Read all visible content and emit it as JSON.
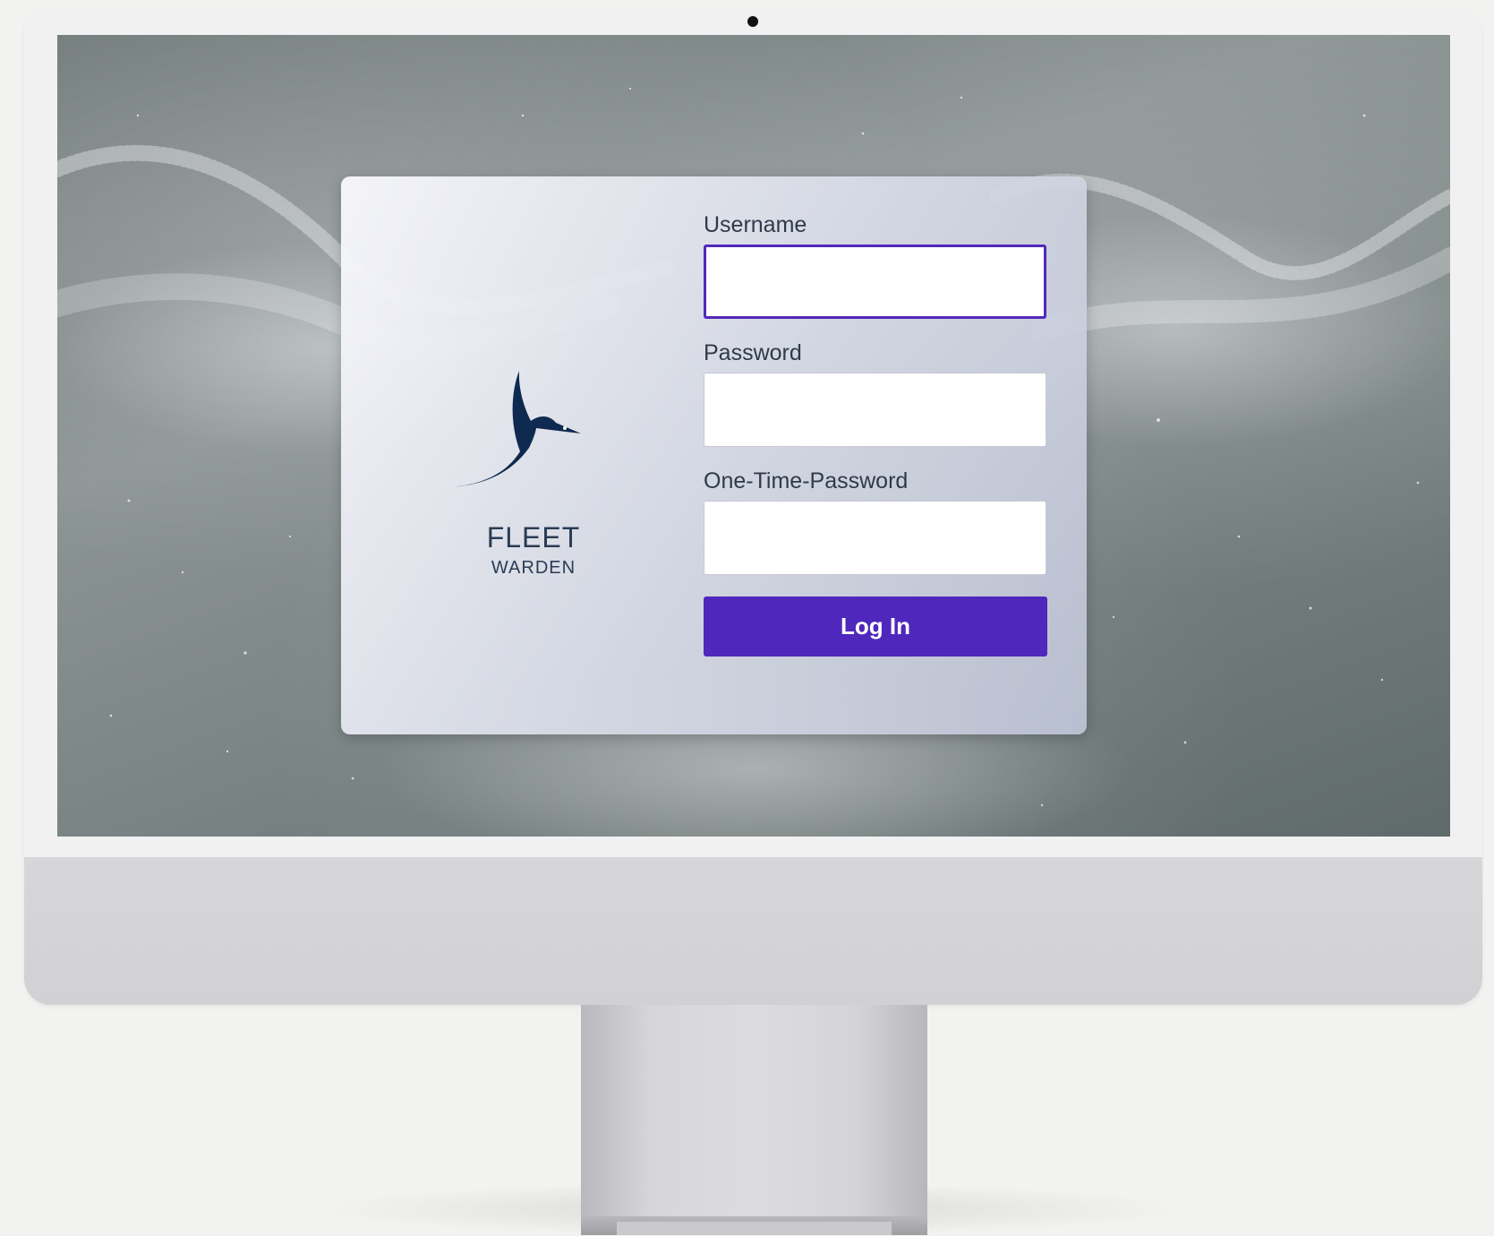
{
  "app": {
    "brand": {
      "name": "FLEET",
      "subtitle": "WARDEN"
    }
  },
  "login": {
    "username_label": "Username",
    "username_value": "",
    "password_label": "Password",
    "password_value": "",
    "otp_label": "One-Time-Password",
    "otp_value": "",
    "submit_label": "Log In"
  },
  "colors": {
    "accent": "#5027bc",
    "brand": "#0e2a50",
    "label_text": "#2f3a4a"
  },
  "icons": {
    "logo": "bird-logo-icon",
    "camera": "camera-icon"
  }
}
